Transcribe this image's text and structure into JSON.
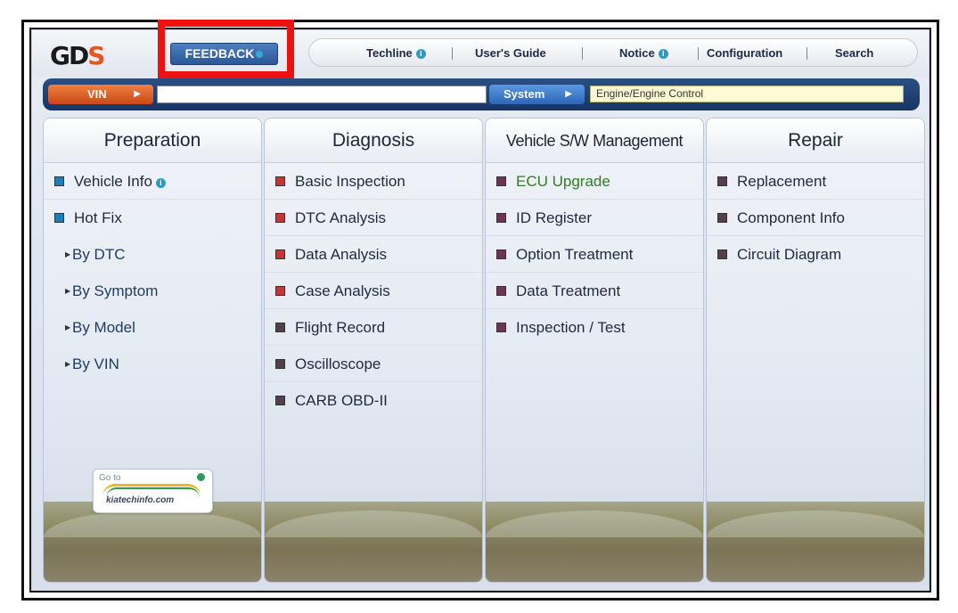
{
  "logo": {
    "text_main": "GD",
    "text_accent": "S"
  },
  "toolbar": {
    "feedback_label": "FEEDBACK",
    "menu": {
      "techline": "Techline",
      "users_guide": "User's Guide",
      "notice": "Notice",
      "configuration": "Configuration",
      "search": "Search"
    },
    "info_glyph": "i"
  },
  "vinbar": {
    "vin_label": "VIN",
    "vin_value": "",
    "system_label": "System",
    "system_value": "Engine/Engine Control"
  },
  "columns": {
    "preparation": {
      "title": "Preparation",
      "items": [
        "Vehicle Info",
        "Hot Fix"
      ],
      "subitems": [
        "By DTC",
        "By Symptom",
        "By Model",
        "By VIN"
      ]
    },
    "diagnosis": {
      "title": "Diagnosis",
      "items": [
        "Basic Inspection",
        "DTC Analysis",
        "Data Analysis",
        "Case Analysis",
        "Flight Record",
        "Oscilloscope",
        "CARB OBD-II"
      ]
    },
    "vehicle_sw": {
      "title": "Vehicle S/W Management",
      "items": [
        "ECU Upgrade",
        "ID Register",
        "Option Treatment",
        "Data Treatment",
        "Inspection / Test"
      ]
    },
    "repair": {
      "title": "Repair",
      "items": [
        "Replacement",
        "Component Info",
        "Circuit Diagram"
      ]
    }
  },
  "kia_link": {
    "goto": "Go to",
    "site": "kiatechinfo.com"
  },
  "colors": {
    "accent_red": "#ee1111",
    "vin_orange": "#e8541e",
    "ecu_green": "#2e7d22"
  }
}
